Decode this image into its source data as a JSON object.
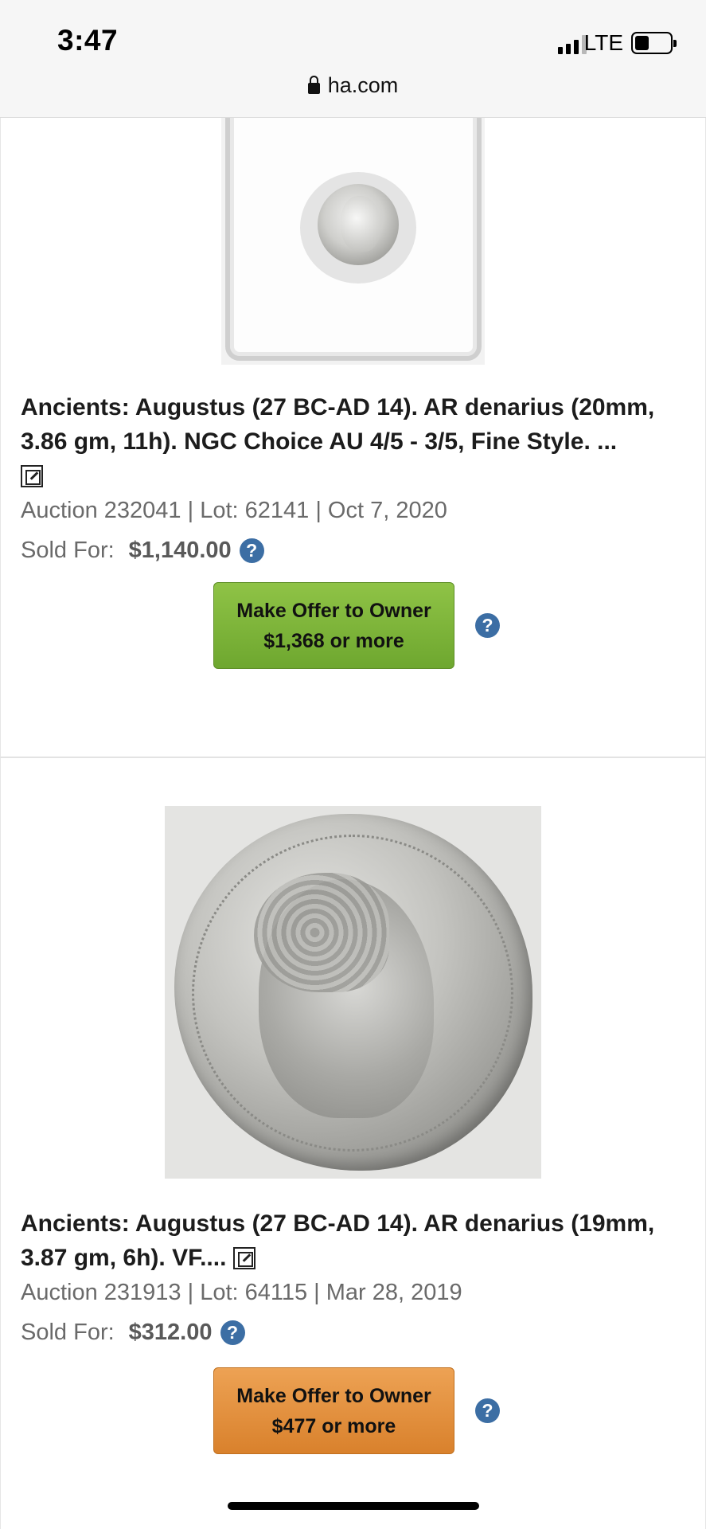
{
  "status_bar": {
    "time": "3:47",
    "network": "LTE",
    "url": "ha.com"
  },
  "lots": [
    {
      "title": "Ancients: Augustus (27 BC-AD 14). AR denarius (20mm, 3.86 gm, 11h). NGC Choice AU 4/5 - 3/5, Fine Style. ...",
      "meta": "Auction 232041 | Lot: 62141 | Oct 7, 2020",
      "sold_label": "Sold For:",
      "sold_price": "$1,140.00",
      "offer_line1": "Make Offer to Owner",
      "offer_line2": "$1,368 or more",
      "offer_color": "#7cb33a"
    },
    {
      "title": "Ancients: Augustus (27 BC-AD 14). AR denarius (19mm, 3.87 gm, 6h). VF....",
      "meta": "Auction 231913 | Lot: 64115 | Mar 28, 2019",
      "sold_label": "Sold For:",
      "sold_price": "$312.00",
      "offer_line1": "Make Offer to Owner",
      "offer_line2": "$477 or more",
      "offer_color": "#e08a35"
    }
  ],
  "help_glyph": "?",
  "icons": [
    "lock-icon",
    "external-link-icon",
    "help-icon"
  ]
}
